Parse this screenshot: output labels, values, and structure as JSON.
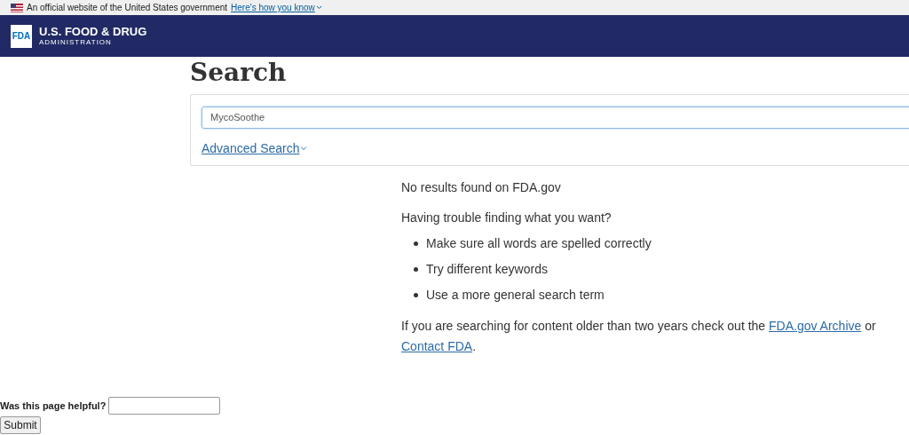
{
  "gov_banner": {
    "text": "An official website of the United States government",
    "link": "Here's how you know"
  },
  "header": {
    "logo_mark": "FDA",
    "title": "U.S. FOOD & DRUG",
    "subtitle": "ADMINISTRATION"
  },
  "page_title": "Search",
  "search": {
    "value": "MycoSoothe",
    "advanced_link": "Advanced Search"
  },
  "results": {
    "message": "No results found on FDA.gov",
    "help_heading": "Having trouble finding what you want?",
    "tips": [
      "Make sure all words are spelled correctly",
      "Try different keywords",
      "Use a more general search term"
    ],
    "archive_note": {
      "before": "If you are searching for content older than two years check out the ",
      "link_1": "FDA.gov Archive",
      "middle": " or ",
      "link_2": "Contact FDA",
      "after": "."
    }
  },
  "feedback": {
    "question": "Was this page helpful?",
    "button": "Submit"
  }
}
